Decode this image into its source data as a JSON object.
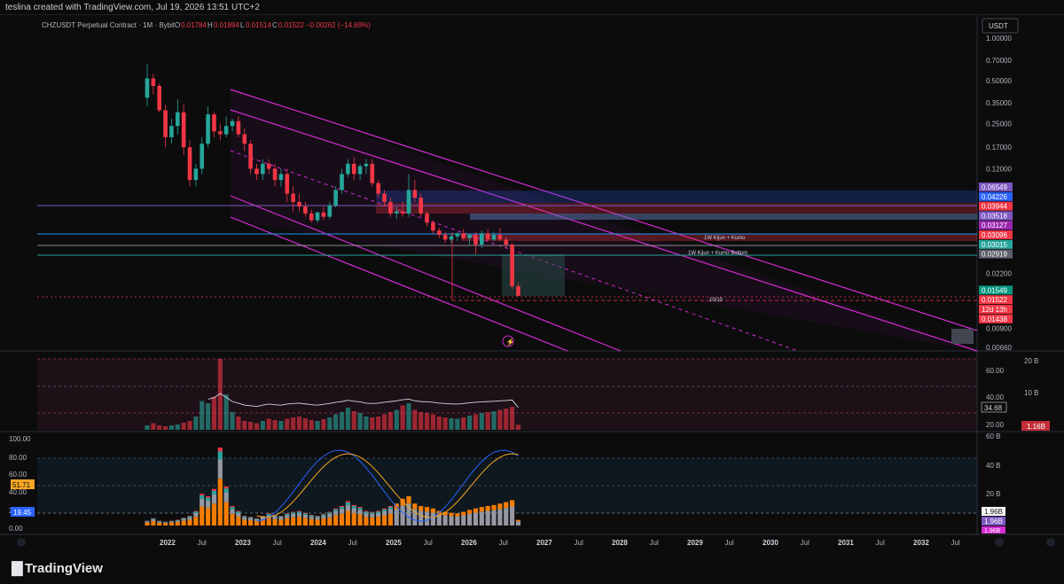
{
  "header": {
    "text": "teslina created with TradingView.com, Jul 19, 2026 13:51 UTC+2"
  },
  "legend": {
    "symbol": "CHZUSDT Perpetual Contract · 1M · Bybit",
    "o_label": "O",
    "o": "0.01784",
    "h_label": "H",
    "h": "0.01894",
    "l_label": "L",
    "l": "0.01514",
    "c_label": "C",
    "c": "0.01522",
    "change": "−0.00262 (−14.69%)"
  },
  "currency_button": "USDT",
  "colors": {
    "up": "#26a69a",
    "down": "#f23645",
    "channel": "#d42ad4",
    "background": "#0c0c0d"
  },
  "chart_data": [
    {
      "type": "candlestick",
      "y_scale": "log",
      "y_axis_ticks": [
        "1.00000",
        "0.70000",
        "0.50000",
        "0.35000",
        "0.25000",
        "0.17000",
        "0.12000",
        "0.02200",
        "0.00900",
        "0.00660"
      ],
      "x_axis_ticks": [
        "2022",
        "Jul",
        "2023",
        "Jul",
        "2024",
        "Jul",
        "2025",
        "Jul",
        "2026",
        "Jul",
        "2027",
        "Jul",
        "2028",
        "Jul",
        "2029",
        "Jul",
        "2030",
        "Jul",
        "2031",
        "Jul",
        "2032",
        "Jul"
      ],
      "series": [
        {
          "name": "CHZUSDT monthly",
          "color_up": "#26a69a",
          "color_down": "#f23645",
          "ohlc": [
            [
              0.38,
              0.66,
              0.33,
              0.52
            ],
            [
              0.52,
              0.56,
              0.4,
              0.46
            ],
            [
              0.46,
              0.48,
              0.3,
              0.31
            ],
            [
              0.31,
              0.34,
              0.17,
              0.2
            ],
            [
              0.2,
              0.27,
              0.18,
              0.24
            ],
            [
              0.24,
              0.37,
              0.21,
              0.3
            ],
            [
              0.3,
              0.34,
              0.15,
              0.17
            ],
            [
              0.17,
              0.19,
              0.09,
              0.1
            ],
            [
              0.1,
              0.13,
              0.09,
              0.12
            ],
            [
              0.12,
              0.2,
              0.11,
              0.18
            ],
            [
              0.18,
              0.33,
              0.17,
              0.29
            ],
            [
              0.29,
              0.3,
              0.2,
              0.22
            ],
            [
              0.22,
              0.25,
              0.19,
              0.21
            ],
            [
              0.21,
              0.28,
              0.2,
              0.24
            ],
            [
              0.24,
              0.27,
              0.22,
              0.26
            ],
            [
              0.26,
              0.28,
              0.2,
              0.21
            ],
            [
              0.21,
              0.23,
              0.16,
              0.18
            ],
            [
              0.18,
              0.19,
              0.11,
              0.12
            ],
            [
              0.12,
              0.13,
              0.1,
              0.11
            ],
            [
              0.11,
              0.14,
              0.1,
              0.13
            ],
            [
              0.13,
              0.14,
              0.11,
              0.12
            ],
            [
              0.12,
              0.13,
              0.09,
              0.1
            ],
            [
              0.1,
              0.12,
              0.09,
              0.11
            ],
            [
              0.11,
              0.12,
              0.07,
              0.08
            ],
            [
              0.08,
              0.09,
              0.06,
              0.07
            ],
            [
              0.07,
              0.08,
              0.06,
              0.065
            ],
            [
              0.065,
              0.07,
              0.055,
              0.058
            ],
            [
              0.058,
              0.062,
              0.05,
              0.052
            ],
            [
              0.052,
              0.06,
              0.05,
              0.059
            ],
            [
              0.059,
              0.065,
              0.052,
              0.055
            ],
            [
              0.055,
              0.07,
              0.053,
              0.066
            ],
            [
              0.066,
              0.09,
              0.064,
              0.085
            ],
            [
              0.085,
              0.12,
              0.08,
              0.11
            ],
            [
              0.11,
              0.14,
              0.105,
              0.13
            ],
            [
              0.13,
              0.145,
              0.1,
              0.11
            ],
            [
              0.11,
              0.13,
              0.1,
              0.125
            ],
            [
              0.125,
              0.14,
              0.11,
              0.13
            ],
            [
              0.13,
              0.14,
              0.09,
              0.095
            ],
            [
              0.095,
              0.1,
              0.075,
              0.08
            ],
            [
              0.08,
              0.085,
              0.065,
              0.07
            ],
            [
              0.07,
              0.075,
              0.055,
              0.058
            ],
            [
              0.058,
              0.065,
              0.053,
              0.06
            ],
            [
              0.06,
              0.07,
              0.055,
              0.058
            ],
            [
              0.058,
              0.11,
              0.055,
              0.085
            ],
            [
              0.085,
              0.1,
              0.07,
              0.075
            ],
            [
              0.075,
              0.08,
              0.055,
              0.058
            ],
            [
              0.058,
              0.06,
              0.047,
              0.05
            ],
            [
              0.05,
              0.052,
              0.042,
              0.044
            ],
            [
              0.044,
              0.046,
              0.039,
              0.041
            ],
            [
              0.041,
              0.043,
              0.036,
              0.038
            ],
            [
              0.038,
              0.042,
              0.036,
              0.04
            ],
            [
              0.04,
              0.043,
              0.037,
              0.042
            ],
            [
              0.042,
              0.045,
              0.038,
              0.039
            ],
            [
              0.039,
              0.042,
              0.035,
              0.041
            ],
            [
              0.041,
              0.043,
              0.03,
              0.035
            ],
            [
              0.035,
              0.044,
              0.033,
              0.042
            ],
            [
              0.042,
              0.045,
              0.037,
              0.038
            ],
            [
              0.038,
              0.043,
              0.037,
              0.041
            ],
            [
              0.041,
              0.046,
              0.037,
              0.038
            ],
            [
              0.038,
              0.04,
              0.033,
              0.035
            ],
            [
              0.035,
              0.036,
              0.017,
              0.01784
            ],
            [
              0.01784,
              0.01894,
              0.01514,
              0.01522
            ]
          ]
        }
      ],
      "price_labels": [
        {
          "value": "0.06549",
          "color": "#7e57c2"
        },
        {
          "value": "0.04226",
          "color": "#2962ff"
        },
        {
          "value": "0.03944",
          "color": "#f23645"
        },
        {
          "value": "0.03518",
          "color": "#7e57c2"
        },
        {
          "value": "0.03127",
          "color": "#9c27b0"
        },
        {
          "value": "0.03096",
          "color": "#f23645"
        },
        {
          "value": "0.03015",
          "color": "#26a69a"
        },
        {
          "value": "0.02919",
          "color": "#5d606b"
        },
        {
          "value": "0.01549",
          "color": "#089981"
        },
        {
          "value": "0.01522",
          "color": "#f23645"
        },
        {
          "value": "12d 13h",
          "color": "#f23645"
        },
        {
          "value": "0.01438",
          "color": "#f23645"
        }
      ],
      "annotations": [
        "1W Kijun + Kumo",
        "1W Kijun + Kumo Bottom",
        "10/10"
      ]
    },
    {
      "type": "bar",
      "name": "volume",
      "y_axis_ticks": [
        "60.00",
        "40.00",
        "20.00"
      ],
      "right_ticks": [
        "20 B",
        "10 B"
      ],
      "last_value": "34.68",
      "last_volume": "1.16B",
      "values": [
        1,
        1.5,
        1,
        0.8,
        1,
        1.2,
        1.6,
        2,
        3,
        6.5,
        6,
        7.5,
        16,
        8,
        4,
        3,
        2,
        1.8,
        1.5,
        2,
        2.5,
        2.2,
        2,
        2.5,
        2.8,
        3,
        2.6,
        2.2,
        2,
        2.4,
        2.8,
        3.5,
        4,
        5,
        4.2,
        3.8,
        3,
        2.8,
        3,
        3.5,
        4,
        4.5,
        5.5,
        6,
        4.5,
        4,
        3.8,
        3.5,
        3,
        2.8,
        2.6,
        2.5,
        2.8,
        3.2,
        3.5,
        3.8,
        4,
        4.2,
        4.5,
        4.8,
        5.2,
        1.16
      ]
    },
    {
      "type": "area",
      "name": "oscillator",
      "y_axis_ticks": [
        "100.00",
        "80.00",
        "60.00",
        "40.00",
        "20.00",
        "0.00"
      ],
      "right_ticks": [
        "60 B",
        "40 B",
        "20 B"
      ],
      "current_values": [
        "51.71",
        "19.45"
      ],
      "right_labels": [
        "1.96B",
        "1.96B",
        "1.96B"
      ]
    }
  ]
}
